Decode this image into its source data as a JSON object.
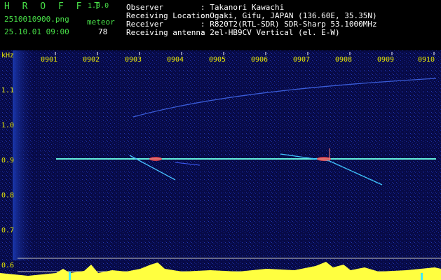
{
  "app": {
    "logo": "H R O F F T",
    "version": "1.0.0"
  },
  "file": {
    "name": "2510010900.png",
    "datetime": "25.10.01 09:00"
  },
  "meteor": {
    "label": "meteor",
    "count": "78"
  },
  "info": {
    "observer_label": "Observer",
    "observer_value": ": Takanori Kawachi",
    "location_label": "Receiving Location",
    "location_value": ": Ogaki, Gifu, JAPAN (136.60E, 35.35N)",
    "receiver_label": "Receiver",
    "receiver_value": ": R820T2(RTL-SDR) SDR-Sharp 53.1000MHz",
    "antenna_label": "Receiving antenna",
    "antenna_value": ": 2el-HB9CV Vertical (el. E-W)"
  },
  "axis": {
    "unit": "kHz",
    "x_ticks": [
      "0901",
      "0902",
      "0903",
      "0904",
      "0905",
      "0906",
      "0907",
      "0908",
      "0909",
      "0910"
    ],
    "y_ticks": [
      "1.1",
      "1.0",
      "0.9",
      "0.8",
      "0.7",
      "0.6"
    ]
  },
  "colors": {
    "header_green": "#48e048",
    "tick_yellow": "#e8e800",
    "carrier": "#40e8ff",
    "spectrum": "#ffff40"
  }
}
